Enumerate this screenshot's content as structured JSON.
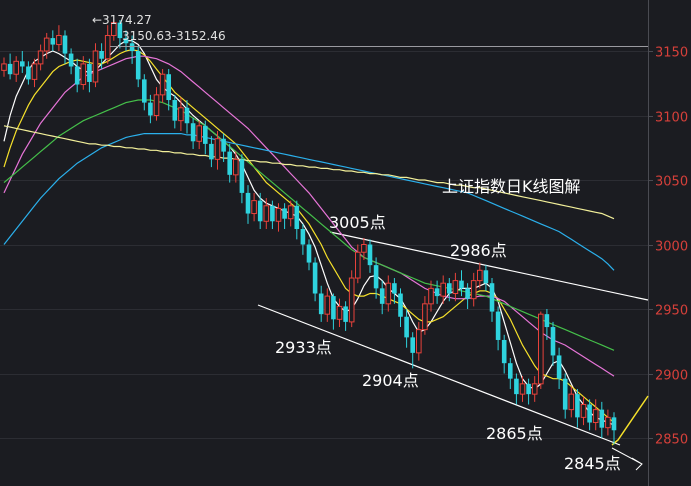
{
  "chart_data": {
    "type": "candlestick",
    "title": "上证指数日K线图解",
    "ylim": [
      2820,
      3190
    ],
    "y_ticks": [
      {
        "value": 3150,
        "label": "3150"
      },
      {
        "value": 3100,
        "label": "3100"
      },
      {
        "value": 3050,
        "label": "3050"
      },
      {
        "value": 3000,
        "label": "3000"
      },
      {
        "value": 2950,
        "label": "2950"
      },
      {
        "value": 2900,
        "label": "2900"
      },
      {
        "value": 2850,
        "label": "2850"
      }
    ],
    "high_marker": {
      "value": 3174.27,
      "label": "←3174.27"
    },
    "range_marker": {
      "low": 3150.63,
      "high": 3152.46,
      "label": "3150.63-3152.46"
    },
    "annotations": [
      {
        "label": "3005点",
        "value": 3005
      },
      {
        "label": "2986点",
        "value": 2986
      },
      {
        "label": "2933点",
        "value": 2933
      },
      {
        "label": "2904点",
        "value": 2904
      },
      {
        "label": "2865点",
        "value": 2865
      },
      {
        "label": "2845点",
        "value": 2845
      }
    ],
    "candles": [
      [
        3135,
        3140,
        3130,
        3145
      ],
      [
        3140,
        3132,
        3128,
        3148
      ],
      [
        3132,
        3142,
        3126,
        3146
      ],
      [
        3142,
        3138,
        3133,
        3150
      ],
      [
        3138,
        3128,
        3124,
        3142
      ],
      [
        3128,
        3140,
        3122,
        3144
      ],
      [
        3140,
        3150,
        3135,
        3155
      ],
      [
        3150,
        3160,
        3144,
        3164
      ],
      [
        3160,
        3155,
        3150,
        3166
      ],
      [
        3155,
        3162,
        3150,
        3170
      ],
      [
        3162,
        3148,
        3140,
        3166
      ],
      [
        3148,
        3138,
        3132,
        3152
      ],
      [
        3138,
        3124,
        3118,
        3144
      ],
      [
        3124,
        3140,
        3120,
        3146
      ],
      [
        3140,
        3126,
        3118,
        3144
      ],
      [
        3126,
        3150,
        3122,
        3156
      ],
      [
        3150,
        3144,
        3136,
        3156
      ],
      [
        3144,
        3162,
        3140,
        3170
      ],
      [
        3162,
        3172,
        3158,
        3174.27
      ],
      [
        3172,
        3160,
        3152,
        3174
      ],
      [
        3160,
        3156,
        3150,
        3166
      ],
      [
        3156,
        3150,
        3140,
        3162
      ],
      [
        3150,
        3128,
        3122,
        3154
      ],
      [
        3128,
        3110,
        3104,
        3132
      ],
      [
        3110,
        3100,
        3094,
        3116
      ],
      [
        3100,
        3116,
        3096,
        3122
      ],
      [
        3116,
        3132,
        3110,
        3136
      ],
      [
        3132,
        3112,
        3104,
        3136
      ],
      [
        3112,
        3096,
        3090,
        3116
      ],
      [
        3096,
        3106,
        3088,
        3114
      ],
      [
        3106,
        3094,
        3086,
        3112
      ],
      [
        3094,
        3080,
        3074,
        3098
      ],
      [
        3080,
        3092,
        3074,
        3096
      ],
      [
        3092,
        3078,
        3070,
        3096
      ],
      [
        3078,
        3066,
        3060,
        3084
      ],
      [
        3066,
        3082,
        3058,
        3088
      ],
      [
        3082,
        3072,
        3064,
        3086
      ],
      [
        3072,
        3054,
        3048,
        3078
      ],
      [
        3054,
        3066,
        3048,
        3072
      ],
      [
        3066,
        3040,
        3032,
        3070
      ],
      [
        3040,
        3024,
        3016,
        3046
      ],
      [
        3024,
        3034,
        3018,
        3040
      ],
      [
        3034,
        3018,
        3012,
        3040
      ],
      [
        3018,
        3030,
        3012,
        3036
      ],
      [
        3030,
        3018,
        3012,
        3034
      ],
      [
        3018,
        3028,
        3010,
        3032
      ],
      [
        3028,
        3020,
        3012,
        3032
      ],
      [
        3020,
        3030,
        3014,
        3034
      ],
      [
        3030,
        3012,
        3004,
        3034
      ],
      [
        3012,
        3000,
        2992,
        3016
      ],
      [
        3000,
        2986,
        2980,
        3004
      ],
      [
        2986,
        2962,
        2956,
        2990
      ],
      [
        2962,
        2946,
        2940,
        2968
      ],
      [
        2946,
        2960,
        2940,
        2966
      ],
      [
        2960,
        2942,
        2934,
        2962
      ],
      [
        2942,
        2952,
        2936,
        2958
      ],
      [
        2952,
        2940,
        2933,
        2956
      ],
      [
        2940,
        2974,
        2936,
        2980
      ],
      [
        2974,
        2994,
        2970,
        3000
      ],
      [
        2994,
        3000,
        2988,
        3005
      ],
      [
        3000,
        2984,
        2978,
        3004
      ],
      [
        2984,
        2966,
        2958,
        2990
      ],
      [
        2966,
        2954,
        2946,
        2972
      ],
      [
        2954,
        2970,
        2948,
        2976
      ],
      [
        2970,
        2962,
        2954,
        2974
      ],
      [
        2962,
        2944,
        2936,
        2966
      ],
      [
        2944,
        2928,
        2920,
        2950
      ],
      [
        2928,
        2916,
        2904,
        2932
      ],
      [
        2916,
        2934,
        2910,
        2940
      ],
      [
        2934,
        2954,
        2930,
        2960
      ],
      [
        2954,
        2966,
        2948,
        2972
      ],
      [
        2966,
        2960,
        2954,
        2972
      ],
      [
        2960,
        2970,
        2954,
        2976
      ],
      [
        2970,
        2962,
        2956,
        2974
      ],
      [
        2962,
        2972,
        2956,
        2978
      ],
      [
        2972,
        2966,
        2960,
        2980
      ],
      [
        2966,
        2958,
        2950,
        2970
      ],
      [
        2958,
        2972,
        2952,
        2978
      ],
      [
        2972,
        2980,
        2966,
        2986
      ],
      [
        2980,
        2970,
        2964,
        2984
      ],
      [
        2970,
        2948,
        2940,
        2974
      ],
      [
        2948,
        2926,
        2918,
        2952
      ],
      [
        2926,
        2908,
        2900,
        2930
      ],
      [
        2908,
        2896,
        2888,
        2912
      ],
      [
        2896,
        2884,
        2876,
        2900
      ],
      [
        2884,
        2892,
        2878,
        2898
      ],
      [
        2892,
        2884,
        2876,
        2896
      ],
      [
        2884,
        2892,
        2878,
        2898
      ],
      [
        2892,
        2946,
        2888,
        2948
      ],
      [
        2946,
        2936,
        2926,
        2950
      ],
      [
        2936,
        2914,
        2906,
        2940
      ],
      [
        2914,
        2896,
        2888,
        2920
      ],
      [
        2896,
        2872,
        2865,
        2900
      ],
      [
        2872,
        2884,
        2866,
        2890
      ],
      [
        2884,
        2866,
        2858,
        2888
      ],
      [
        2866,
        2876,
        2860,
        2882
      ],
      [
        2876,
        2862,
        2856,
        2880
      ],
      [
        2862,
        2872,
        2856,
        2880
      ],
      [
        2872,
        2858,
        2850,
        2878
      ],
      [
        2858,
        2866,
        2852,
        2872
      ],
      [
        2866,
        2856,
        2845,
        2870
      ]
    ],
    "moving_averages": [
      {
        "color": "#ffffff",
        "values": [
          3080,
          3100,
          3115,
          3125,
          3135,
          3142,
          3145,
          3148,
          3150,
          3148,
          3145,
          3142,
          3138,
          3135,
          3133,
          3135,
          3140,
          3145,
          3150,
          3155,
          3158,
          3158,
          3155,
          3148,
          3138,
          3128,
          3122,
          3118,
          3115,
          3110,
          3105,
          3100,
          3096,
          3092,
          3088,
          3084,
          3080,
          3076,
          3070,
          3062,
          3052,
          3042,
          3036,
          3032,
          3030,
          3028,
          3026,
          3024,
          3022,
          3016,
          3008,
          2998,
          2984,
          2970,
          2958,
          2952,
          2948,
          2950,
          2958,
          2968,
          2975,
          2976,
          2972,
          2966,
          2962,
          2958,
          2950,
          2940,
          2932,
          2934,
          2940,
          2948,
          2956,
          2962,
          2964,
          2966,
          2966,
          2966,
          2968,
          2970,
          2966,
          2956,
          2940,
          2924,
          2908,
          2896,
          2890,
          2888,
          2892,
          2900,
          2908,
          2910,
          2902,
          2892,
          2882,
          2876,
          2870,
          2866,
          2864,
          2862,
          2860
        ]
      },
      {
        "color": "#f6e12b",
        "values": [
          3060,
          3075,
          3088,
          3098,
          3108,
          3116,
          3122,
          3128,
          3134,
          3138,
          3140,
          3142,
          3143,
          3142,
          3141,
          3140,
          3140,
          3142,
          3145,
          3148,
          3150,
          3151,
          3150,
          3147,
          3142,
          3136,
          3130,
          3124,
          3118,
          3114,
          3110,
          3106,
          3102,
          3098,
          3094,
          3090,
          3086,
          3082,
          3078,
          3072,
          3066,
          3060,
          3054,
          3048,
          3044,
          3040,
          3036,
          3032,
          3028,
          3022,
          3016,
          3008,
          3000,
          2990,
          2982,
          2974,
          2966,
          2962,
          2960,
          2960,
          2962,
          2962,
          2960,
          2958,
          2956,
          2954,
          2950,
          2946,
          2942,
          2940,
          2940,
          2942,
          2944,
          2948,
          2952,
          2956,
          2960,
          2962,
          2964,
          2964,
          2962,
          2958,
          2950,
          2942,
          2932,
          2922,
          2914,
          2906,
          2900,
          2898,
          2896,
          2896,
          2894,
          2890,
          2886,
          2882,
          2878,
          2874,
          2870,
          2866,
          2862
        ]
      },
      {
        "color": "#e775d8",
        "values": [
          3040,
          3050,
          3060,
          3070,
          3078,
          3086,
          3094,
          3100,
          3106,
          3112,
          3118,
          3122,
          3126,
          3130,
          3132,
          3134,
          3136,
          3138,
          3140,
          3142,
          3144,
          3145,
          3146,
          3146,
          3145,
          3144,
          3142,
          3140,
          3137,
          3134,
          3130,
          3126,
          3122,
          3118,
          3114,
          3110,
          3106,
          3102,
          3098,
          3094,
          3090,
          3085,
          3080,
          3075,
          3070,
          3065,
          3060,
          3055,
          3050,
          3045,
          3040,
          3034,
          3028,
          3022,
          3016,
          3010,
          3004,
          2998,
          2994,
          2990,
          2988,
          2986,
          2984,
          2982,
          2980,
          2978,
          2975,
          2972,
          2969,
          2966,
          2964,
          2962,
          2960,
          2959,
          2958,
          2958,
          2958,
          2959,
          2960,
          2960,
          2960,
          2958,
          2956,
          2952,
          2948,
          2944,
          2940,
          2936,
          2932,
          2929,
          2926,
          2924,
          2922,
          2919,
          2916,
          2913,
          2910,
          2907,
          2904,
          2901,
          2898
        ]
      },
      {
        "color": "#45c04a",
        "values": [
          3048,
          3052,
          3056,
          3060,
          3064,
          3068,
          3072,
          3076,
          3080,
          3084,
          3087,
          3090,
          3093,
          3096,
          3098,
          3100,
          3102,
          3104,
          3106,
          3108,
          3110,
          3111,
          3112,
          3112,
          3112,
          3111,
          3110,
          3108,
          3106,
          3104,
          3101,
          3098,
          3095,
          3092,
          3088,
          3084,
          3080,
          3076,
          3072,
          3068,
          3064,
          3060,
          3056,
          3052,
          3048,
          3044,
          3040,
          3036,
          3032,
          3028,
          3024,
          3020,
          3016,
          3012,
          3008,
          3004,
          3000,
          2996,
          2993,
          2990,
          2988,
          2986,
          2984,
          2982,
          2980,
          2978,
          2976,
          2974,
          2972,
          2970,
          2969,
          2968,
          2967,
          2966,
          2965,
          2964,
          2963,
          2962,
          2961,
          2960,
          2958,
          2956,
          2954,
          2952,
          2950,
          2948,
          2946,
          2944,
          2942,
          2940,
          2938,
          2936,
          2934,
          2932,
          2930,
          2928,
          2926,
          2924,
          2922,
          2920,
          2918
        ]
      },
      {
        "color": "#2bb0ec",
        "values": [
          3000,
          3006,
          3012,
          3018,
          3024,
          3030,
          3036,
          3041,
          3046,
          3051,
          3055,
          3059,
          3063,
          3066,
          3069,
          3072,
          3075,
          3077,
          3079,
          3081,
          3083,
          3084,
          3085,
          3086,
          3086,
          3086,
          3086,
          3086,
          3086,
          3086,
          3085,
          3085,
          3084,
          3083,
          3082,
          3081,
          3080,
          3079,
          3078,
          3077,
          3076,
          3075,
          3074,
          3073,
          3072,
          3071,
          3070,
          3069,
          3068,
          3067,
          3066,
          3065,
          3064,
          3063,
          3062,
          3061,
          3060,
          3059,
          3058,
          3057,
          3056,
          3055,
          3054,
          3053,
          3052,
          3051,
          3050,
          3049,
          3048,
          3047,
          3046,
          3045,
          3044,
          3043,
          3042,
          3041,
          3040,
          3038,
          3036,
          3034,
          3032,
          3030,
          3028,
          3026,
          3024,
          3022,
          3020,
          3018,
          3016,
          3014,
          3012,
          3010,
          3007,
          3004,
          3001,
          2998,
          2995,
          2992,
          2989,
          2985,
          2980
        ]
      },
      {
        "color": "#f3f09a",
        "values": [
          3092,
          3091,
          3090,
          3089,
          3088,
          3087,
          3086,
          3085,
          3084,
          3083,
          3082,
          3081,
          3080,
          3079,
          3078,
          3078,
          3077,
          3077,
          3076,
          3076,
          3075,
          3075,
          3074,
          3074,
          3073,
          3073,
          3072,
          3072,
          3071,
          3071,
          3070,
          3070,
          3069,
          3069,
          3068,
          3068,
          3067,
          3067,
          3066,
          3066,
          3065,
          3065,
          3064,
          3064,
          3063,
          3063,
          3062,
          3062,
          3061,
          3061,
          3060,
          3060,
          3059,
          3059,
          3058,
          3058,
          3057,
          3057,
          3056,
          3056,
          3055,
          3055,
          3054,
          3054,
          3053,
          3052,
          3052,
          3051,
          3050,
          3050,
          3049,
          3048,
          3048,
          3047,
          3046,
          3046,
          3045,
          3044,
          3044,
          3043,
          3042,
          3041,
          3040,
          3039,
          3038,
          3037,
          3036,
          3035,
          3034,
          3033,
          3032,
          3031,
          3030,
          3029,
          3028,
          3027,
          3026,
          3025,
          3024,
          3022,
          3020
        ]
      }
    ]
  }
}
